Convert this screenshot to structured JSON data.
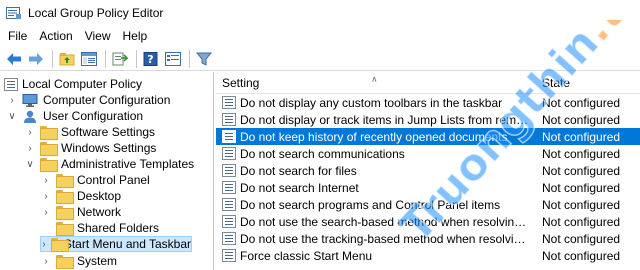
{
  "window": {
    "title": "Local Group Policy Editor"
  },
  "menu": [
    "File",
    "Action",
    "View",
    "Help"
  ],
  "toolbar": {
    "buttons": [
      "back-icon",
      "forward-icon",
      "up-folder-icon",
      "show-hide-tree-icon",
      "export-list-icon",
      "help-icon",
      "properties-icon",
      "filter-icon"
    ]
  },
  "tree": {
    "root": "Local Computer Policy",
    "items": [
      {
        "label": "Computer Configuration",
        "level": 1,
        "expanded": false
      },
      {
        "label": "User Configuration",
        "level": 1,
        "expanded": true
      },
      {
        "label": "Software Settings",
        "level": 2,
        "expanded": false
      },
      {
        "label": "Windows Settings",
        "level": 2,
        "expanded": false
      },
      {
        "label": "Administrative Templates",
        "level": 2,
        "expanded": true
      },
      {
        "label": "Control Panel",
        "level": 3,
        "expanded": false
      },
      {
        "label": "Desktop",
        "level": 3,
        "expanded": false
      },
      {
        "label": "Network",
        "level": 3,
        "expanded": false
      },
      {
        "label": "Shared Folders",
        "level": 3,
        "expanded": false
      },
      {
        "label": "Start Menu and Taskbar",
        "level": 3,
        "expanded": false,
        "selected": true
      },
      {
        "label": "System",
        "level": 3,
        "expanded": false
      }
    ]
  },
  "list": {
    "columns": {
      "setting": "Setting",
      "state": "State"
    },
    "rows": [
      {
        "setting": "Do not display any custom toolbars in the taskbar",
        "state": "Not configured"
      },
      {
        "setting": "Do not display or track items in Jump Lists from remote loca...",
        "state": "Not configured"
      },
      {
        "setting": "Do not keep history of recently opened documents",
        "state": "Not configured",
        "selected": true
      },
      {
        "setting": "Do not search communications",
        "state": "Not configured"
      },
      {
        "setting": "Do not search for files",
        "state": "Not configured"
      },
      {
        "setting": "Do not search Internet",
        "state": "Not configured"
      },
      {
        "setting": "Do not search programs and Control Panel items",
        "state": "Not configured"
      },
      {
        "setting": "Do not use the search-based method when resolving shell s...",
        "state": "Not configured"
      },
      {
        "setting": "Do not use the tracking-based method when resolving shell ...",
        "state": "Not configured"
      },
      {
        "setting": "Force classic Start Menu",
        "state": "Not configured"
      }
    ]
  },
  "watermark": {
    "text": "Truongthin.top"
  },
  "colors": {
    "selection": "#0078d7",
    "tree_selection": "#cce8ff",
    "watermark": "#1e90ff",
    "watermark_accent": "#ff8c1a"
  }
}
